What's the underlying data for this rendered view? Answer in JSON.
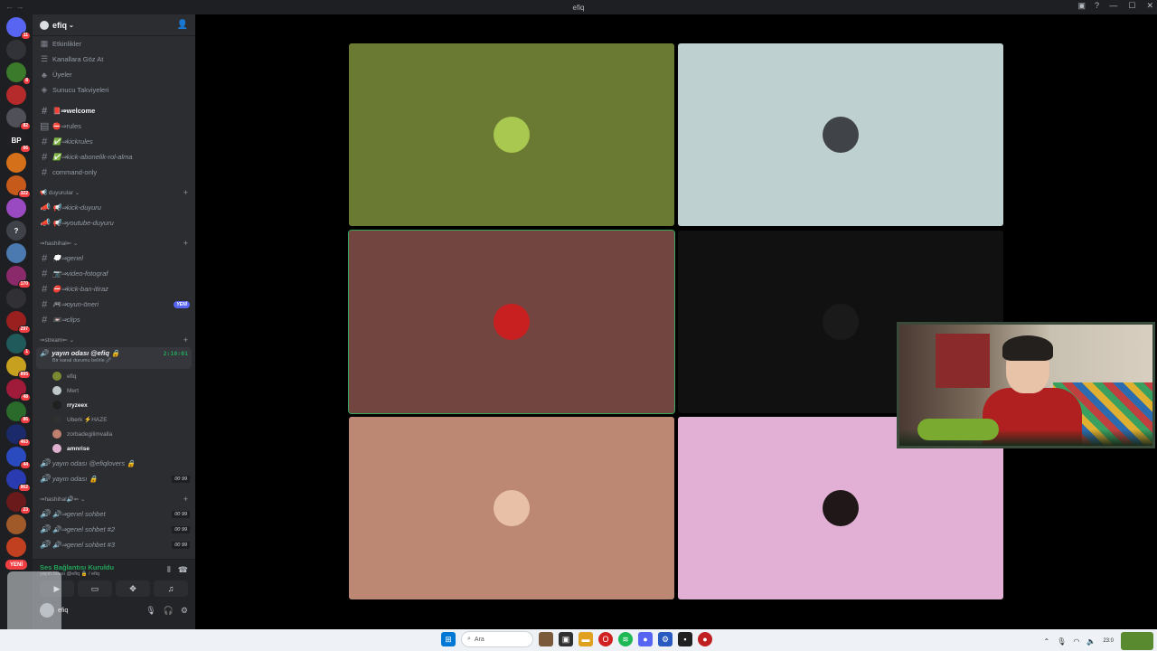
{
  "window": {
    "title": "efiq"
  },
  "servers": [
    {
      "icon": "discord-home-icon",
      "color": "#5865f2",
      "badge": "11"
    },
    {
      "icon": "robot-icon",
      "color": "#313338",
      "badge": ""
    },
    {
      "icon": "server-green",
      "color": "#3a7a2a",
      "badge": "8"
    },
    {
      "icon": "server-red",
      "color": "#b52a2a",
      "badge": ""
    },
    {
      "icon": "server-gray",
      "color": "#505058",
      "badge": "82"
    },
    {
      "icon": "server-bp",
      "color": "#202025",
      "badge": "66",
      "text": "BP"
    },
    {
      "icon": "server-orange",
      "color": "#d5701a",
      "badge": ""
    },
    {
      "icon": "server-brown",
      "color": "#c55a1a",
      "badge": "322"
    },
    {
      "icon": "server-purple",
      "color": "#9a4ac0",
      "badge": ""
    },
    {
      "icon": "server-help",
      "color": "#404249",
      "badge": "",
      "text": "?"
    },
    {
      "icon": "server-blue",
      "color": "#4a7ab0",
      "badge": ""
    },
    {
      "icon": "server-pink",
      "color": "#8a2a6a",
      "badge": "170"
    },
    {
      "icon": "server-dark",
      "color": "#303035",
      "badge": ""
    },
    {
      "icon": "server-red2",
      "color": "#9a2020",
      "badge": "297"
    },
    {
      "icon": "server-teal",
      "color": "#205a5a",
      "badge": "1"
    },
    {
      "icon": "server-yellow",
      "color": "#c8a020",
      "badge": "895"
    },
    {
      "icon": "server-crimson",
      "color": "#a01a3a",
      "badge": "48"
    },
    {
      "icon": "server-green2",
      "color": "#2a6a2a",
      "badge": "86"
    },
    {
      "icon": "server-navy",
      "color": "#1a2a6a",
      "badge": "463"
    },
    {
      "icon": "server-blue2",
      "color": "#2a4ac0",
      "badge": "44"
    },
    {
      "icon": "server-indigo",
      "color": "#2a3ab0",
      "badge": "962"
    },
    {
      "icon": "server-maroon",
      "color": "#6a1a1a",
      "badge": "23"
    },
    {
      "icon": "server-bronze",
      "color": "#a05a2a",
      "badge": ""
    },
    {
      "icon": "server-poker",
      "color": "#c04020",
      "badge": ""
    }
  ],
  "new_badge": "YENİ",
  "guild": {
    "name": "efiq"
  },
  "menu": [
    {
      "icon": "calendar-icon",
      "glyph": "▦",
      "label": "Etkinlikler"
    },
    {
      "icon": "browse-channels-icon",
      "glyph": "☰",
      "label": "Kanallara Göz At"
    },
    {
      "icon": "members-icon",
      "glyph": "♣",
      "label": "Üyeler"
    },
    {
      "icon": "boost-icon",
      "glyph": "◈",
      "label": "Sunucu Takviyeleri"
    }
  ],
  "text_channels": [
    {
      "name": "📕⇒welcome",
      "bold": true,
      "italic": false,
      "icon": "hash-icon",
      "glyph": "#"
    },
    {
      "name": "⛔⇒rules",
      "bold": false,
      "italic": false,
      "icon": "rules-icon",
      "glyph": "▤"
    },
    {
      "name": "✅⇒kickrules",
      "bold": false,
      "italic": true,
      "icon": "hash-icon",
      "glyph": "#"
    },
    {
      "name": "✅⇒kick-abonelik-rol-alma",
      "bold": false,
      "italic": true,
      "icon": "hash-icon",
      "glyph": "#"
    },
    {
      "name": "command-only",
      "bold": false,
      "italic": false,
      "icon": "hash-icon",
      "glyph": "#"
    }
  ],
  "cat_duyurular": {
    "label": "📢 duyurular ⌄"
  },
  "duyurular": [
    {
      "name": "📢⇒kick-duyuru"
    },
    {
      "name": "📢⇒youtube-duyuru"
    }
  ],
  "cat_hashihal": {
    "label": "⇒hashihal⇐ ⌄"
  },
  "hashihal_channels": [
    {
      "name": "💭⇒genel",
      "badge": ""
    },
    {
      "name": "📷⇒video-fotograf",
      "badge": ""
    },
    {
      "name": "⛔⇒kick-ban-itiraz",
      "badge": ""
    },
    {
      "name": "🎮⇒oyun-öneri",
      "badge": "YENİ"
    },
    {
      "name": "📼⇒clips",
      "badge": ""
    }
  ],
  "cat_stream": {
    "label": "⇒stream⇐ ⌄"
  },
  "active_voice": {
    "name": "yayın odası @efiq 🔒",
    "timer": "2:10:01",
    "status": "Bir kanal durumu belirle 🖉"
  },
  "members": [
    {
      "name": "efiq",
      "color": "#7a8a30",
      "bold": false
    },
    {
      "name": "Mert",
      "color": "#c0c8c8",
      "bold": false
    },
    {
      "name": "rryzeex",
      "color": "#202020",
      "bold": true
    },
    {
      "name": "Uberk ⚡HAZE",
      "color": "#303030",
      "bold": false
    },
    {
      "name": "zorbadegilimvalla",
      "color": "#c08070",
      "bold": false
    },
    {
      "name": "amnrise",
      "color": "#e0b0d0",
      "bold": true
    }
  ],
  "voice_channels": [
    {
      "name": "yayın odası @efiqlovers 🔒",
      "count": ""
    },
    {
      "name": "yayın odası 🔒",
      "count": "00 99"
    }
  ],
  "cat_hashihal2": {
    "label": "⇒hashihal🔊⇐ ⌄"
  },
  "voice_channels2": [
    {
      "name": "🔊⇒genel sohbet",
      "count": "00 99"
    },
    {
      "name": "🔊⇒genel sohbet #2",
      "count": "00 99"
    },
    {
      "name": "🔊⇒genel sohbet #3",
      "count": "00 99"
    }
  ],
  "voice_panel": {
    "status": "Ses Bağlantısı Kuruldu",
    "sub": "yayın odası @efiq 🔒 / efiq",
    "user": "efiq"
  },
  "tiles": [
    {
      "color": "#6b7a33",
      "avatar": "#a8c850",
      "speaking": false
    },
    {
      "color": "#bfd0d0",
      "avatar": "#404448",
      "speaking": false
    },
    {
      "color": "#734540",
      "avatar": "#c82020",
      "speaking": true
    },
    {
      "color": "#111111",
      "avatar": "#1a1a1a",
      "speaking": false
    },
    {
      "color": "#bc8874",
      "avatar": "#e8c0a8",
      "speaking": false
    },
    {
      "color": "#e2b0d4",
      "avatar": "#201818",
      "speaking": false
    }
  ],
  "taskbar": {
    "search_placeholder": "Ara",
    "time": "23:0",
    "date": ""
  }
}
